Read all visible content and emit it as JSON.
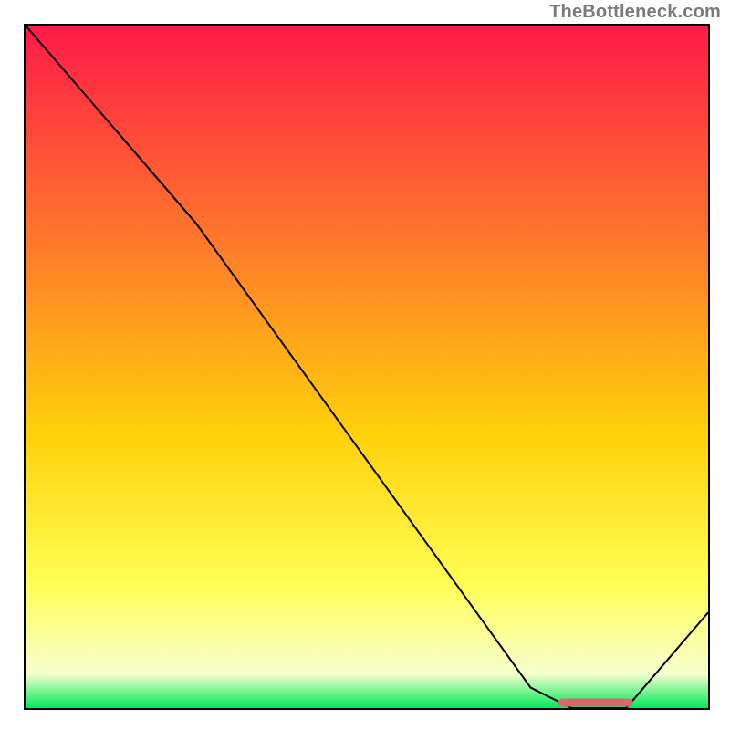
{
  "attribution": "TheBottleneck.com",
  "colors": {
    "grad_top": "#ff1a49",
    "grad_upper_mid": "#ff7a2a",
    "grad_mid": "#ffd20a",
    "grad_lower_mid": "#ffff55",
    "grad_pale": "#f7ffce",
    "grad_bottom": "#00e85a",
    "curve": "#000000",
    "marker": "#d46a6a"
  },
  "chart_data": {
    "type": "line",
    "title": "",
    "xlabel": "",
    "ylabel": "",
    "xlim": [
      0,
      100
    ],
    "ylim": [
      0,
      100
    ],
    "series": [
      {
        "name": "bottleneck-curve",
        "x": [
          0,
          25,
          74,
          80,
          88,
          100
        ],
        "values": [
          100,
          71,
          3,
          0,
          0,
          14
        ]
      }
    ],
    "marker": {
      "name": "optimal-range",
      "x_start": 78,
      "x_end": 89,
      "y": 0.5
    }
  }
}
